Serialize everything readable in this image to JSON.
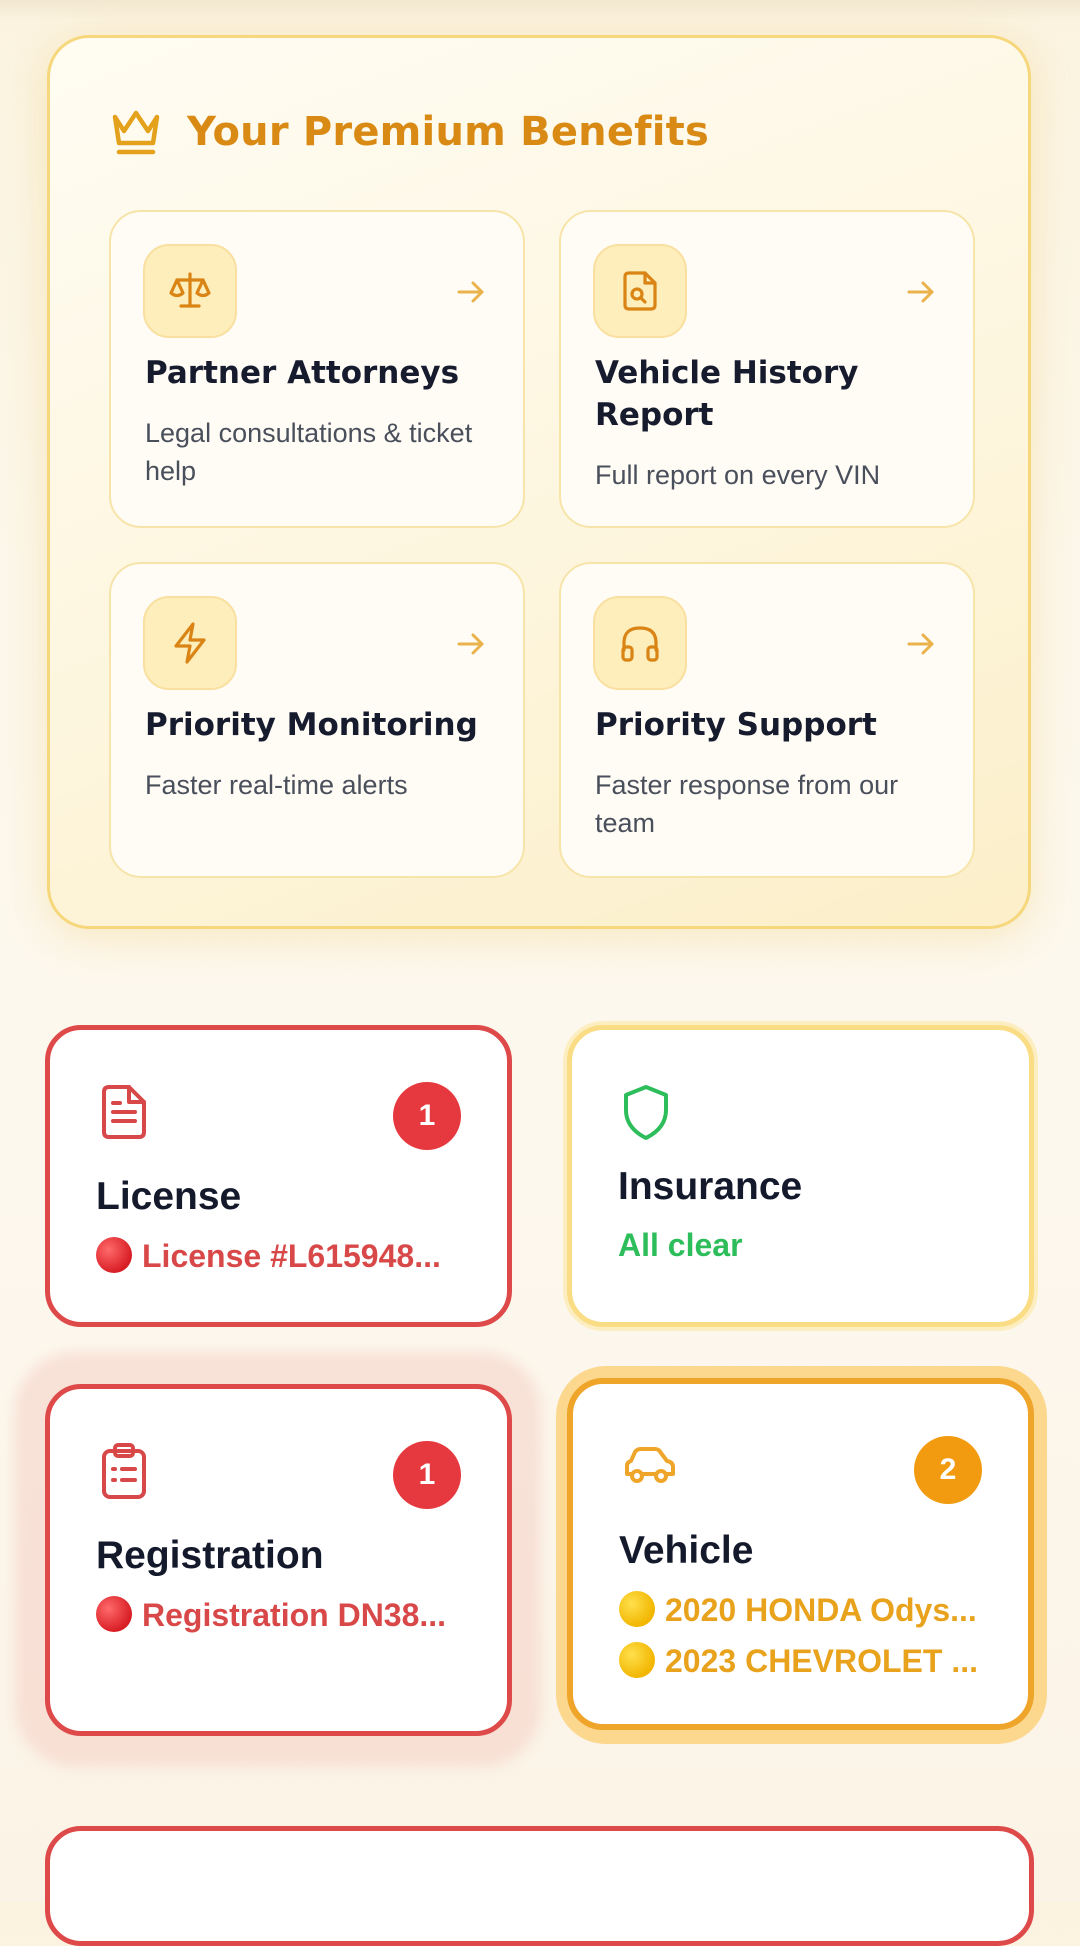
{
  "premium": {
    "title": "Your Premium Benefits",
    "icon": "crown-icon",
    "benefits": [
      {
        "icon": "scale-icon",
        "title": "Partner Attorneys",
        "description": "Legal consultations & ticket help"
      },
      {
        "icon": "document-search-icon",
        "title": "Vehicle History Report",
        "description": "Full report on every VIN"
      },
      {
        "icon": "lightning-icon",
        "title": "Priority Monitoring",
        "description": "Faster real-time alerts"
      },
      {
        "icon": "headphones-icon",
        "title": "Priority Support",
        "description": "Faster response from our team"
      }
    ]
  },
  "status_cards": {
    "license": {
      "icon": "document-icon",
      "title": "License",
      "badge": "1",
      "items": [
        "License #L615948..."
      ]
    },
    "insurance": {
      "icon": "shield-icon",
      "title": "Insurance",
      "status": "All clear"
    },
    "registration": {
      "icon": "clipboard-icon",
      "title": "Registration",
      "badge": "1",
      "items": [
        "Registration DN38..."
      ]
    },
    "vehicle": {
      "icon": "car-icon",
      "title": "Vehicle",
      "badge": "2",
      "items": [
        "2020 HONDA Odys...",
        "2023 CHEVROLET ..."
      ]
    }
  },
  "colors": {
    "premium_accent": "#d98a14",
    "alert_red": "#de4a4a",
    "ok_green": "#2dbd5a",
    "warning_amber": "#efa52a"
  }
}
